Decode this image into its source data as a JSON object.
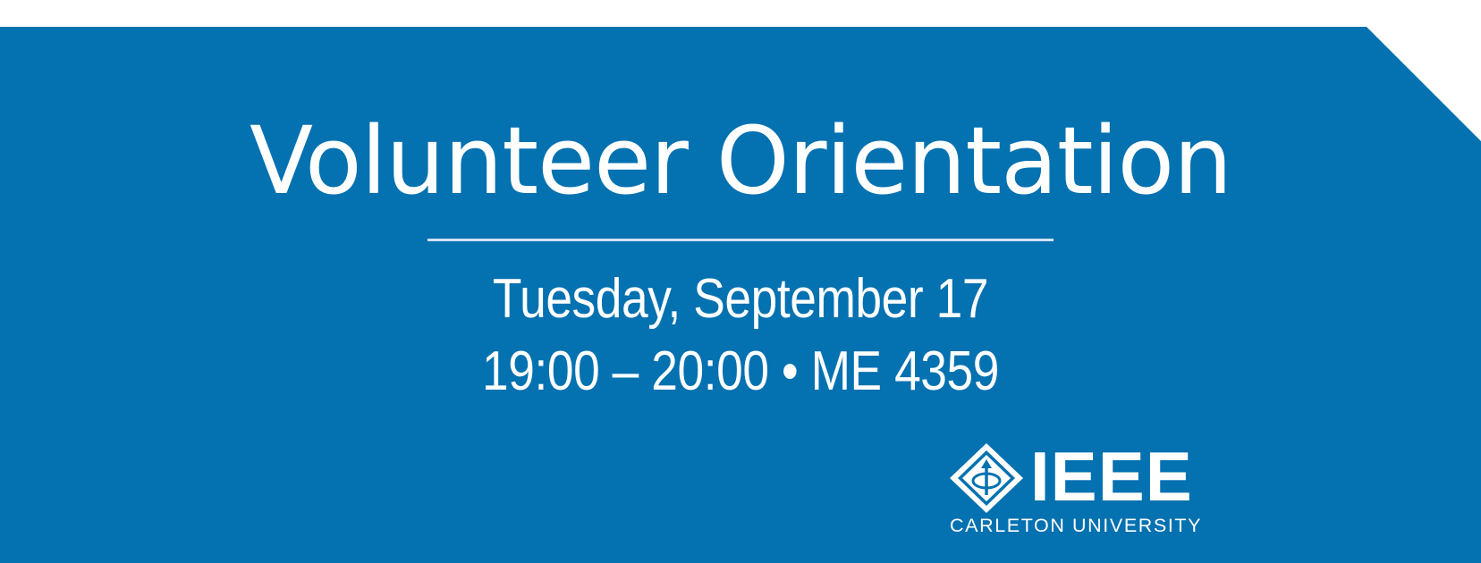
{
  "event": {
    "title": "Volunteer Orientation",
    "date": "Tuesday, September 17",
    "time_location": "19:00 – 20:00 • ME 4359"
  },
  "logo": {
    "wordmark": "IEEE",
    "subtitle": "CARLETON UNIVERSITY",
    "icon": "ieee-kite-icon"
  },
  "colors": {
    "banner": "#0471b0",
    "text": "#ffffff",
    "background": "#ffffff",
    "divider": "#cfe3f1"
  }
}
